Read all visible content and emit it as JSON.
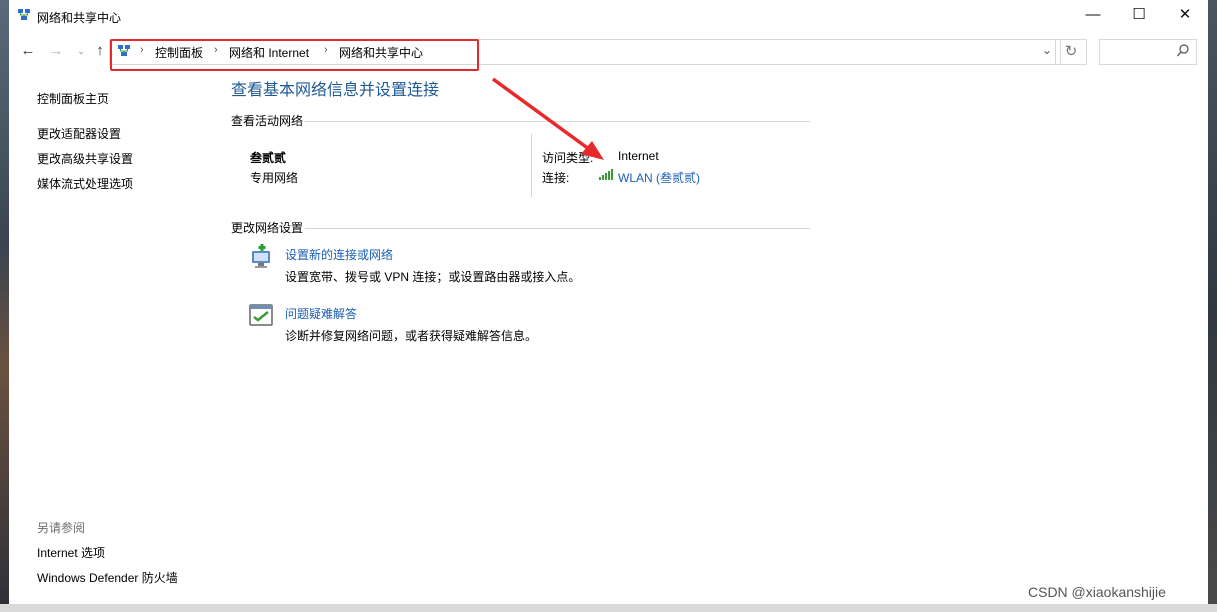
{
  "window": {
    "title": "网络和共享中心",
    "minimize": "—",
    "maximize": "☐",
    "close": "✕"
  },
  "nav": {
    "back_icon": "back-arrow-icon",
    "breadcrumbs": [
      "控制面板",
      "网络和 Internet",
      "网络和共享中心"
    ],
    "refresh_icon": "refresh-icon",
    "search_placeholder": ""
  },
  "sidebar": {
    "items": [
      "控制面板主页",
      "更改适配器设置",
      "更改高级共享设置",
      "媒体流式处理选项"
    ],
    "see_also_title": "另请参阅",
    "see_also": [
      "Internet 选项",
      "Windows Defender 防火墙"
    ]
  },
  "main": {
    "title": "查看基本网络信息并设置连接",
    "active_networks_heading": "查看活动网络",
    "network_name": "叁贰贰",
    "network_profile": "专用网络",
    "access_type_label": "访问类型:",
    "access_type_value": "Internet",
    "connections_label": "连接:",
    "connection_value": "WLAN (叁贰贰)",
    "change_settings_heading": "更改网络设置",
    "tasks": [
      {
        "title": "设置新的连接或网络",
        "desc": "设置宽带、拨号或 VPN 连接；或设置路由器或接入点。"
      },
      {
        "title": "问题疑难解答",
        "desc": "诊断并修复网络问题，或者获得疑难解答信息。"
      }
    ]
  },
  "watermark": "CSDN @xiaokanshijie",
  "colors": {
    "accent": "#1e5a96",
    "link": "#1a5fb4",
    "annotation": "#e8292c"
  }
}
